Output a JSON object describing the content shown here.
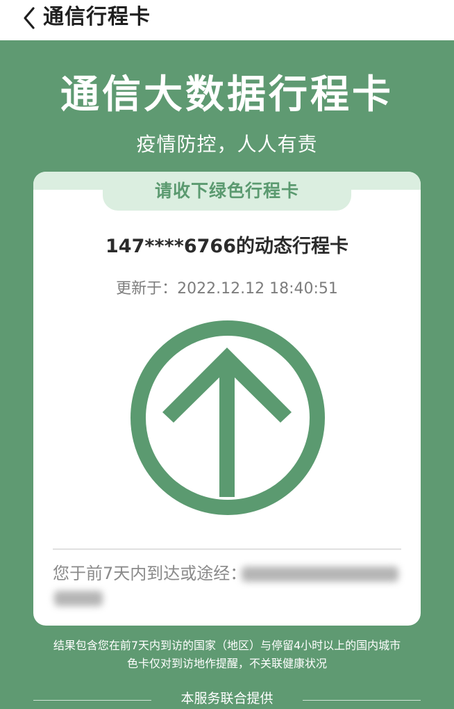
{
  "nav": {
    "title": "通信行程卡",
    "back_icon": "chevron-left-icon"
  },
  "header": {
    "main_title": "通信大数据行程卡",
    "slogan": "疫情防控，人人有责"
  },
  "card": {
    "tab_label": "请收下绿色行程卡",
    "phone_title": "147****6766的动态行程卡",
    "update_label": "更新于：",
    "update_time": "2022.12.12 18:40:51",
    "status_icon": "green-up-arrow-icon",
    "route_label": "您于前7天内到达或途经："
  },
  "footer": {
    "note_line1": "结果包含您在前7天内到访的国家（地区）与停留4小时以上的国内城市",
    "note_line2": "色卡仅对到访地作提醒，不关联健康状况",
    "provider": "本服务联合提供"
  },
  "colors": {
    "background_green": "#5f9a72",
    "tab_band": "#dbeee0",
    "status_green": "#5b9a70",
    "card_white": "#ffffff"
  }
}
